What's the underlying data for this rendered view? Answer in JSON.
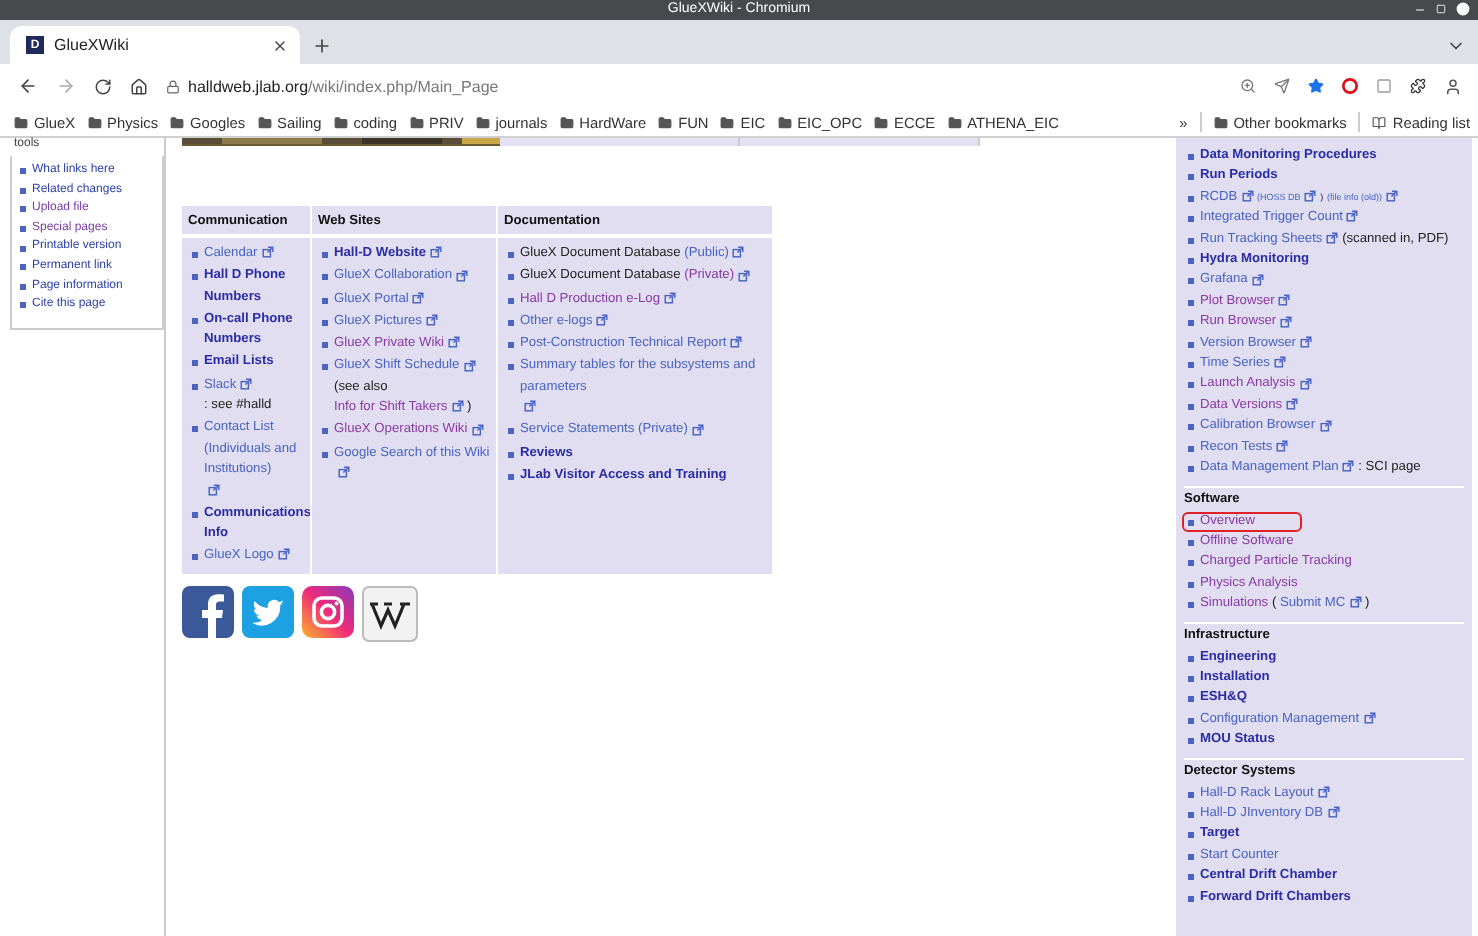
{
  "window": {
    "title": "GlueXWiki - Chromium"
  },
  "tabs": [
    {
      "label": "GlueXWiki",
      "favicon": "D",
      "selected": true
    }
  ],
  "address_bar": {
    "domain": "halldweb.jlab.org",
    "path": "/wiki/index.php/Main_Page"
  },
  "bookmarks": [
    "GlueX",
    "Physics",
    "Googles",
    "Sailing",
    "coding",
    "PRIV",
    "journals",
    "HardWare",
    "FUN",
    "EIC",
    "EIC_OPC",
    "ECCE",
    "ATHENA_EIC"
  ],
  "bookmarks_overflow": "»",
  "other_bookmarks": "Other bookmarks",
  "reading_list": "Reading list",
  "sidebar": {
    "title": "tools",
    "items": [
      {
        "label": "What links here",
        "visited": false
      },
      {
        "label": "Related changes",
        "visited": false
      },
      {
        "label": "Upload file",
        "visited": true
      },
      {
        "label": "Special pages",
        "visited": true
      },
      {
        "label": "Printable version",
        "visited": false
      },
      {
        "label": "Permanent link",
        "visited": false
      },
      {
        "label": "Page information",
        "visited": false
      },
      {
        "label": "Cite this page",
        "visited": false
      }
    ]
  },
  "table": {
    "columns": [
      "Communication",
      "Web Sites",
      "Documentation"
    ],
    "cells": [
      [
        {
          "parts": [
            {
              "text": "Calendar",
              "kind": "external",
              "ext": true
            }
          ]
        },
        {
          "parts": [
            {
              "text": "Hall D Phone Numbers",
              "kind": "internal"
            }
          ]
        },
        {
          "parts": [
            {
              "text": "On-call Phone Numbers",
              "kind": "internal"
            }
          ]
        },
        {
          "parts": [
            {
              "text": "Email Lists",
              "kind": "internal"
            }
          ]
        },
        {
          "parts": [
            {
              "text": "Slack",
              "kind": "external",
              "ext": true
            },
            {
              "text": ": see #halld",
              "kind": "plain"
            }
          ]
        },
        {
          "parts": [
            {
              "text": "Contact List (Individuals and Institutions)",
              "kind": "external",
              "ext": true
            }
          ]
        },
        {
          "parts": [
            {
              "text": "Communications Info",
              "kind": "internal"
            }
          ]
        },
        {
          "parts": [
            {
              "text": "GlueX Logo",
              "kind": "external",
              "ext": true
            }
          ]
        }
      ],
      [
        {
          "parts": [
            {
              "text": "Hall-D Website",
              "kind": "internal",
              "ext": true
            }
          ]
        },
        {
          "parts": [
            {
              "text": "GlueX Collaboration",
              "kind": "external",
              "ext": true
            }
          ]
        },
        {
          "parts": [
            {
              "text": "GlueX Portal",
              "kind": "external",
              "ext": true
            }
          ]
        },
        {
          "parts": [
            {
              "text": "GlueX Pictures",
              "kind": "external",
              "ext": true
            }
          ]
        },
        {
          "parts": [
            {
              "text": "GlueX Private Wiki",
              "kind": "visited",
              "ext": true
            }
          ]
        },
        {
          "parts": [
            {
              "text": "GlueX Shift Schedule",
              "kind": "external",
              "ext": true
            },
            {
              "text": "(see also",
              "kind": "plain"
            },
            {
              "text": "Info for Shift Takers",
              "kind": "visited",
              "ext": true
            },
            {
              "text": ")",
              "kind": "plain"
            }
          ]
        },
        {
          "parts": [
            {
              "text": "GlueX Operations Wiki",
              "kind": "visited",
              "ext": true
            }
          ]
        },
        {
          "parts": [
            {
              "text": "Google Search of this Wiki",
              "kind": "external",
              "ext": true
            }
          ]
        }
      ],
      [
        {
          "parts": [
            {
              "text": "GlueX Document Database",
              "kind": "plain"
            },
            {
              "text": "(Public)",
              "kind": "external",
              "ext": true
            }
          ]
        },
        {
          "parts": [
            {
              "text": "GlueX Document Database",
              "kind": "plain"
            },
            {
              "text": "(Private)",
              "kind": "visited",
              "ext": true
            }
          ]
        },
        {
          "parts": [
            {
              "text": "Hall D Production e-Log",
              "kind": "visited",
              "ext": true
            }
          ]
        },
        {
          "parts": [
            {
              "text": "Other e-logs",
              "kind": "external",
              "ext": true
            }
          ]
        },
        {
          "parts": [
            {
              "text": "Post-Construction Technical Report",
              "kind": "external",
              "ext": true
            }
          ]
        },
        {
          "parts": [
            {
              "text": "Summary tables for the subsystems and parameters",
              "kind": "external",
              "ext": true
            }
          ]
        },
        {
          "parts": [
            {
              "text": "Service Statements (Private)",
              "kind": "external",
              "ext": true
            }
          ]
        },
        {
          "parts": [
            {
              "text": "Reviews",
              "kind": "internal"
            }
          ]
        },
        {
          "parts": [
            {
              "text": "JLab Visitor Access and Training",
              "kind": "internal"
            }
          ]
        }
      ]
    ]
  },
  "social": [
    {
      "kind": "facebook"
    },
    {
      "kind": "twitter"
    },
    {
      "kind": "instagram"
    },
    {
      "kind": "wikipedia"
    }
  ],
  "right_column": [
    {
      "items": [
        {
          "parts": [
            {
              "text": "Data Monitoring Procedures",
              "kind": "internal"
            }
          ]
        },
        {
          "parts": [
            {
              "text": "Run Periods",
              "kind": "internal"
            }
          ]
        },
        {
          "parts": [
            {
              "text": "RCDB",
              "kind": "external",
              "ext": true
            },
            {
              "text": "(HOSS DB",
              "kind": "small",
              "ext": true
            },
            {
              "text": ")",
              "kind": "small"
            },
            {
              "text": "(file info (old))",
              "kind": "small",
              "ext": true
            }
          ]
        },
        {
          "parts": [
            {
              "text": "Integrated Trigger Count",
              "kind": "external",
              "ext": true
            }
          ]
        },
        {
          "parts": [
            {
              "text": "Run Tracking Sheets",
              "kind": "external",
              "ext": true
            },
            {
              "text": "(scanned in, PDF)",
              "kind": "plain"
            }
          ]
        },
        {
          "parts": [
            {
              "text": "Hydra Monitoring",
              "kind": "internal"
            }
          ]
        },
        {
          "parts": [
            {
              "text": "Grafana",
              "kind": "external",
              "ext": true
            }
          ]
        },
        {
          "parts": [
            {
              "text": "Plot Browser",
              "kind": "visited",
              "ext": true
            }
          ]
        },
        {
          "parts": [
            {
              "text": "Run Browser",
              "kind": "visited",
              "ext": true
            }
          ]
        },
        {
          "parts": [
            {
              "text": "Version Browser",
              "kind": "external",
              "ext": true
            }
          ]
        },
        {
          "parts": [
            {
              "text": "Time Series",
              "kind": "external",
              "ext": true
            }
          ]
        },
        {
          "parts": [
            {
              "text": "Launch Analysis",
              "kind": "visited",
              "ext": true
            }
          ]
        },
        {
          "parts": [
            {
              "text": "Data Versions",
              "kind": "visited",
              "ext": true
            }
          ]
        },
        {
          "parts": [
            {
              "text": "Calibration Browser",
              "kind": "external",
              "ext": true
            }
          ]
        },
        {
          "parts": [
            {
              "text": "Recon Tests",
              "kind": "external",
              "ext": true
            }
          ]
        },
        {
          "parts": [
            {
              "text": "Data Management Plan",
              "kind": "external",
              "ext": true
            },
            {
              "text": ": SCI page",
              "kind": "plain"
            }
          ]
        }
      ]
    },
    {
      "title": "Software",
      "items": [
        {
          "parts": [
            {
              "text": "Overview",
              "kind": "visited"
            }
          ],
          "circled": true
        },
        {
          "parts": [
            {
              "text": "Offline Software",
              "kind": "visited"
            }
          ],
          "circled": false
        },
        {
          "parts": [
            {
              "text": "Charged Particle Tracking",
              "kind": "visited"
            }
          ],
          "circled": false
        },
        {
          "parts": [
            {
              "text": "Physics Analysis",
              "kind": "visited"
            }
          ],
          "circled": false
        },
        {
          "parts": [
            {
              "text": "Simulations",
              "kind": "visited"
            },
            {
              "text": "(",
              "kind": "plain"
            },
            {
              "text": "Submit MC",
              "kind": "external",
              "ext": true
            },
            {
              "text": ")",
              "kind": "plain"
            }
          ],
          "circled": false
        }
      ]
    },
    {
      "title": "Infrastructure",
      "items": [
        {
          "parts": [
            {
              "text": "Engineering",
              "kind": "internal"
            }
          ]
        },
        {
          "parts": [
            {
              "text": "Installation",
              "kind": "internal"
            }
          ]
        },
        {
          "parts": [
            {
              "text": "ESH&Q",
              "kind": "internal"
            }
          ]
        },
        {
          "parts": [
            {
              "text": "Configuration Management",
              "kind": "external",
              "ext": true
            }
          ]
        },
        {
          "parts": [
            {
              "text": "MOU Status",
              "kind": "internal"
            }
          ]
        }
      ]
    },
    {
      "title": "Detector Systems",
      "items": [
        {
          "parts": [
            {
              "text": "Hall-D Rack Layout",
              "kind": "external",
              "ext": true
            }
          ]
        },
        {
          "parts": [
            {
              "text": "Hall-D JInventory DB",
              "kind": "external",
              "ext": true
            }
          ]
        },
        {
          "parts": [
            {
              "text": "Target",
              "kind": "internal"
            }
          ]
        },
        {
          "parts": [
            {
              "text": "Start Counter",
              "kind": "external"
            }
          ]
        },
        {
          "parts": [
            {
              "text": "Central Drift Chamber",
              "kind": "internal"
            }
          ]
        },
        {
          "parts": [
            {
              "text": "Forward Drift Chambers",
              "kind": "internal"
            }
          ]
        }
      ]
    }
  ]
}
